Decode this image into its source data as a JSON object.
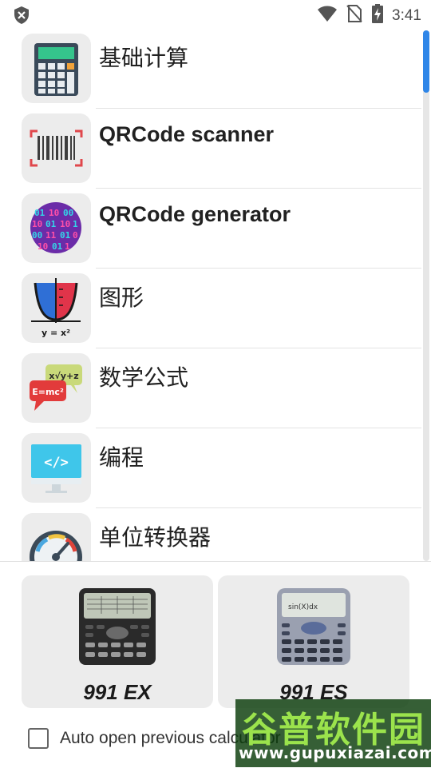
{
  "status_bar": {
    "time": "3:41",
    "icons": [
      "shield-icon",
      "wifi-icon",
      "no-sim-icon",
      "battery-charging-icon"
    ]
  },
  "menu": {
    "items": [
      {
        "label": "基础计算",
        "icon": "calculator-icon"
      },
      {
        "label": "QRCode scanner",
        "icon": "barcode-scan-icon"
      },
      {
        "label": "QRCode generator",
        "icon": "binary-globe-icon"
      },
      {
        "label": "图形",
        "icon": "parabola-graph-icon"
      },
      {
        "label": "数学公式",
        "icon": "formula-bubbles-icon"
      },
      {
        "label": "编程",
        "icon": "code-monitor-icon"
      },
      {
        "label": "单位转换器",
        "icon": "gauge-icon"
      }
    ]
  },
  "calculators": [
    {
      "label": "991 EX",
      "icon": "calculator-991ex-icon"
    },
    {
      "label": "991 ES",
      "icon": "calculator-991es-icon"
    }
  ],
  "auto_open": {
    "label": "Auto open previous calculator",
    "checked": false
  },
  "watermark": {
    "title": "谷普软件园",
    "url": "www.gupuxiazai.com"
  },
  "colors": {
    "accent": "#2f86e8",
    "tile_bg": "#ececec"
  }
}
